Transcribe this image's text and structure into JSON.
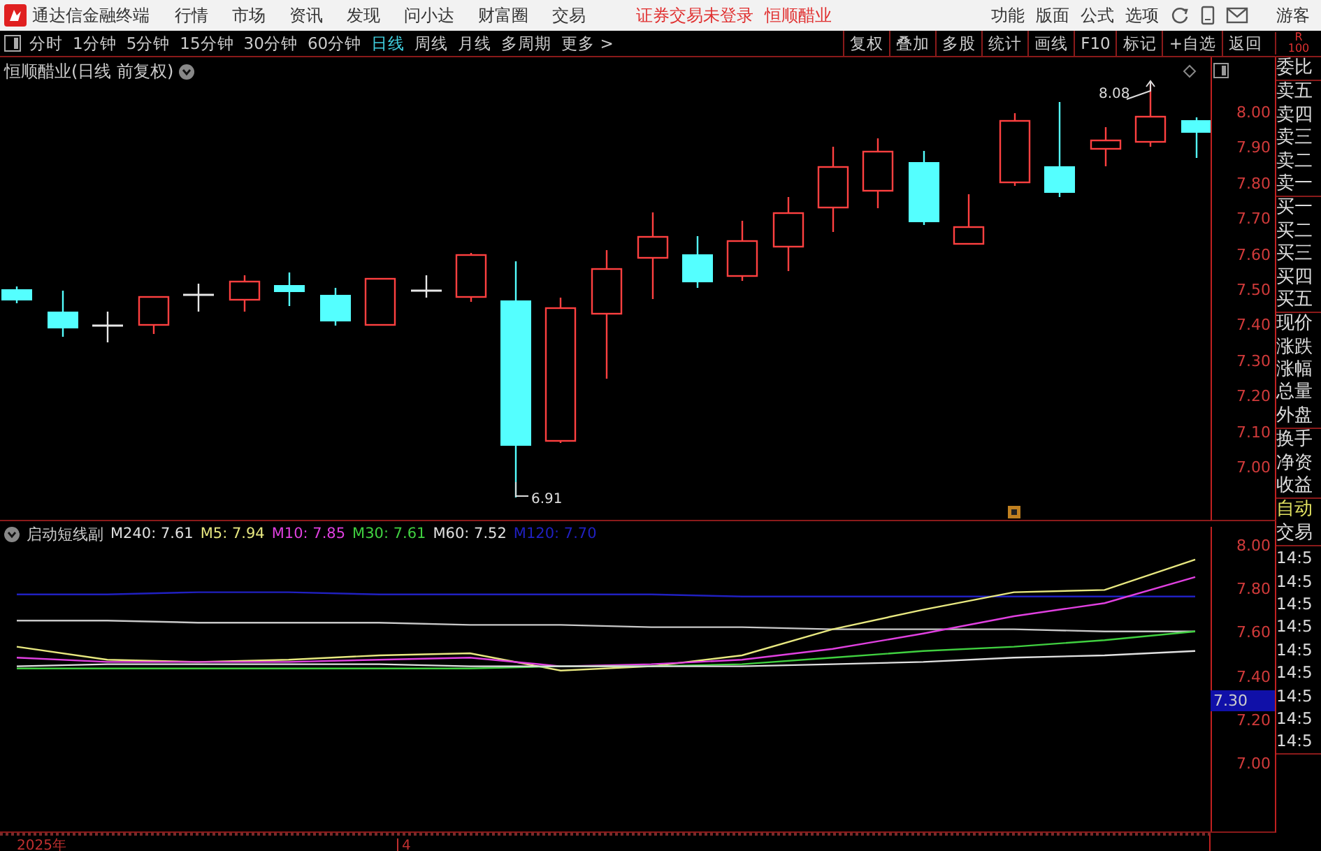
{
  "app": {
    "title": "通达信金融终端"
  },
  "menu": [
    "行情",
    "市场",
    "资讯",
    "发现",
    "问小达",
    "财富圈",
    "交易"
  ],
  "notices": [
    "证券交易未登录",
    "恒顺醋业"
  ],
  "tools": [
    "功能",
    "版面",
    "公式",
    "选项"
  ],
  "user": "游客",
  "periods": [
    {
      "label": "分时",
      "selected": false
    },
    {
      "label": "1分钟",
      "selected": false
    },
    {
      "label": "5分钟",
      "selected": false
    },
    {
      "label": "15分钟",
      "selected": false
    },
    {
      "label": "30分钟",
      "selected": false
    },
    {
      "label": "60分钟",
      "selected": false
    },
    {
      "label": "日线",
      "selected": true
    },
    {
      "label": "周线",
      "selected": false
    },
    {
      "label": "月线",
      "selected": false
    },
    {
      "label": "多周期",
      "selected": false
    },
    {
      "label": "更多 >",
      "selected": false
    }
  ],
  "actions": [
    "复权",
    "叠加",
    "多股",
    "统计",
    "画线",
    "F10",
    "标记",
    "+自选",
    "返回"
  ],
  "corner": [
    "R",
    "100"
  ],
  "chart_title": "恒顺醋业(日线 前复权)",
  "price_ticks": [
    "8.00",
    "7.90",
    "7.80",
    "7.70",
    "7.60",
    "7.50",
    "7.40",
    "7.30",
    "7.20",
    "7.10",
    "7.00"
  ],
  "high_label": "8.08",
  "low_label": "6.91",
  "indicator": {
    "name": "启动短线副",
    "legend": [
      {
        "text": "M240: 7.61",
        "color": "#e0e0e0"
      },
      {
        "text": "M5: 7.94",
        "color": "#e8e880"
      },
      {
        "text": "M10: 7.85",
        "color": "#e040e0"
      },
      {
        "text": "M30: 7.61",
        "color": "#40d040"
      },
      {
        "text": "M60: 7.52",
        "color": "#e0e0e0"
      },
      {
        "text": "M120: 7.70",
        "color": "#2020c0"
      }
    ],
    "chart_data": {
      "type": "line",
      "ylim": [
        6.686,
        8.09
      ],
      "yticks": [
        {
          "value": 8,
          "label": "8.00"
        },
        {
          "value": 7.8,
          "label": "7.80"
        },
        {
          "value": 7.6,
          "label": "7.60"
        },
        {
          "value": 7.4,
          "label": "7.40"
        },
        {
          "value": 7.2,
          "label": "7.20"
        },
        {
          "value": 7,
          "label": "7.00"
        }
      ],
      "series": [
        {
          "color": "#2020c0",
          "values": [
            7.78,
            7.78,
            7.79,
            7.79,
            7.78,
            7.78,
            7.78,
            7.78,
            7.77,
            7.77,
            7.77,
            7.77,
            7.77,
            7.77
          ]
        },
        {
          "color": "#c8c8c8",
          "values": [
            7.66,
            7.66,
            7.65,
            7.65,
            7.65,
            7.64,
            7.64,
            7.63,
            7.63,
            7.62,
            7.62,
            7.62,
            7.61,
            7.61
          ]
        },
        {
          "color": "#e8e880",
          "values": [
            7.54,
            7.48,
            7.47,
            7.48,
            7.5,
            7.51,
            7.43,
            7.45,
            7.5,
            7.62,
            7.71,
            7.79,
            7.8,
            7.94
          ]
        },
        {
          "color": "#e040e0",
          "values": [
            7.49,
            7.47,
            7.47,
            7.47,
            7.48,
            7.49,
            7.45,
            7.46,
            7.48,
            7.53,
            7.6,
            7.68,
            7.74,
            7.86
          ]
        },
        {
          "color": "#40d040",
          "values": [
            7.44,
            7.44,
            7.44,
            7.44,
            7.44,
            7.44,
            7.45,
            7.45,
            7.46,
            7.49,
            7.52,
            7.54,
            7.57,
            7.61
          ]
        },
        {
          "color": "#e0e0e0",
          "values": [
            7.45,
            7.46,
            7.46,
            7.46,
            7.46,
            7.45,
            7.45,
            7.45,
            7.45,
            7.46,
            7.47,
            7.49,
            7.5,
            7.52
          ]
        }
      ]
    },
    "current": "7.30"
  },
  "panel": [
    [
      {
        "text": "委比",
        "highlighted": false
      }
    ],
    [
      {
        "text": "卖五",
        "highlighted": false
      },
      {
        "text": "卖四",
        "highlighted": false
      },
      {
        "text": "卖三",
        "highlighted": false
      },
      {
        "text": "卖二",
        "highlighted": false
      },
      {
        "text": "卖一",
        "highlighted": false
      }
    ],
    [
      {
        "text": "买一",
        "highlighted": false
      },
      {
        "text": "买二",
        "highlighted": false
      },
      {
        "text": "买三",
        "highlighted": false
      },
      {
        "text": "买四",
        "highlighted": false
      },
      {
        "text": "买五",
        "highlighted": false
      }
    ],
    [
      {
        "text": "现价",
        "highlighted": false
      },
      {
        "text": "涨跌",
        "highlighted": false
      },
      {
        "text": "涨幅",
        "highlighted": false
      },
      {
        "text": "总量",
        "highlighted": false
      },
      {
        "text": "外盘",
        "highlighted": false
      }
    ],
    [
      {
        "text": "换手",
        "highlighted": false
      },
      {
        "text": "净资",
        "highlighted": false
      },
      {
        "text": "收益",
        "highlighted": false
      }
    ],
    [
      {
        "text": "自动",
        "highlighted": true
      },
      {
        "text": "交易",
        "highlighted": false
      }
    ],
    [
      {
        "text": "14:5",
        "highlighted": false
      },
      {
        "text": "14:5",
        "highlighted": false
      },
      {
        "text": "14:5",
        "highlighted": false
      },
      {
        "text": "14:5",
        "highlighted": false
      },
      {
        "text": "14:5",
        "highlighted": false
      },
      {
        "text": "14:5",
        "highlighted": false
      },
      {
        "text": "14:5",
        "highlighted": false
      },
      {
        "text": "14:5",
        "highlighted": false
      },
      {
        "text": "14:5",
        "highlighted": false
      }
    ]
  ],
  "time_axis": [
    "2025年",
    "4"
  ]
}
